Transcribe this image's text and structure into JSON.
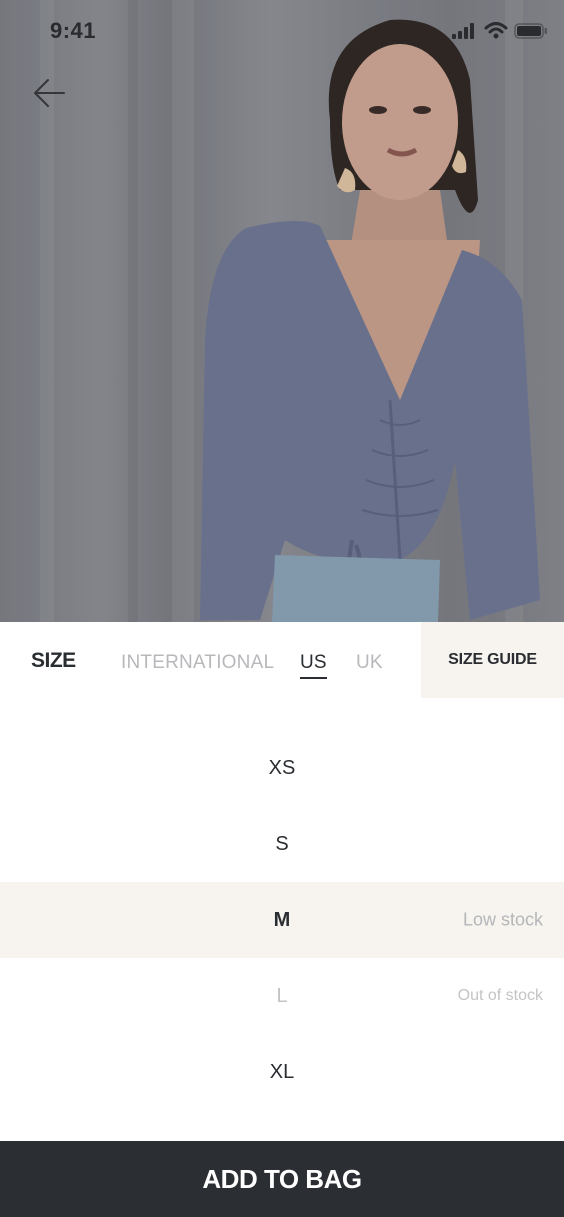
{
  "status_bar": {
    "time": "9:41",
    "icons": [
      "signal-icon",
      "wifi-icon",
      "battery-icon"
    ]
  },
  "hero": {
    "image": "product-photo",
    "back_icon": "arrow-left-icon"
  },
  "size_selector": {
    "title": "SIZE",
    "tabs": [
      {
        "label": "INTERNATIONAL",
        "active": false
      },
      {
        "label": "US",
        "active": true
      },
      {
        "label": "UK",
        "active": false
      }
    ],
    "size_guide_label": "SIZE GUIDE",
    "sizes": [
      {
        "label": "XS",
        "note": "",
        "state": "available"
      },
      {
        "label": "S",
        "note": "",
        "state": "available"
      },
      {
        "label": "M",
        "note": "Low stock",
        "state": "selected"
      },
      {
        "label": "L",
        "note": "Out of stock",
        "state": "disabled"
      },
      {
        "label": "XL",
        "note": "",
        "state": "available"
      }
    ]
  },
  "cta": {
    "label": "ADD TO BAG"
  },
  "colors": {
    "dark": "#2b2e32",
    "highlight": "#f7f4f0",
    "muted_text": "#b7b8bb",
    "garment": "#6f7794"
  }
}
